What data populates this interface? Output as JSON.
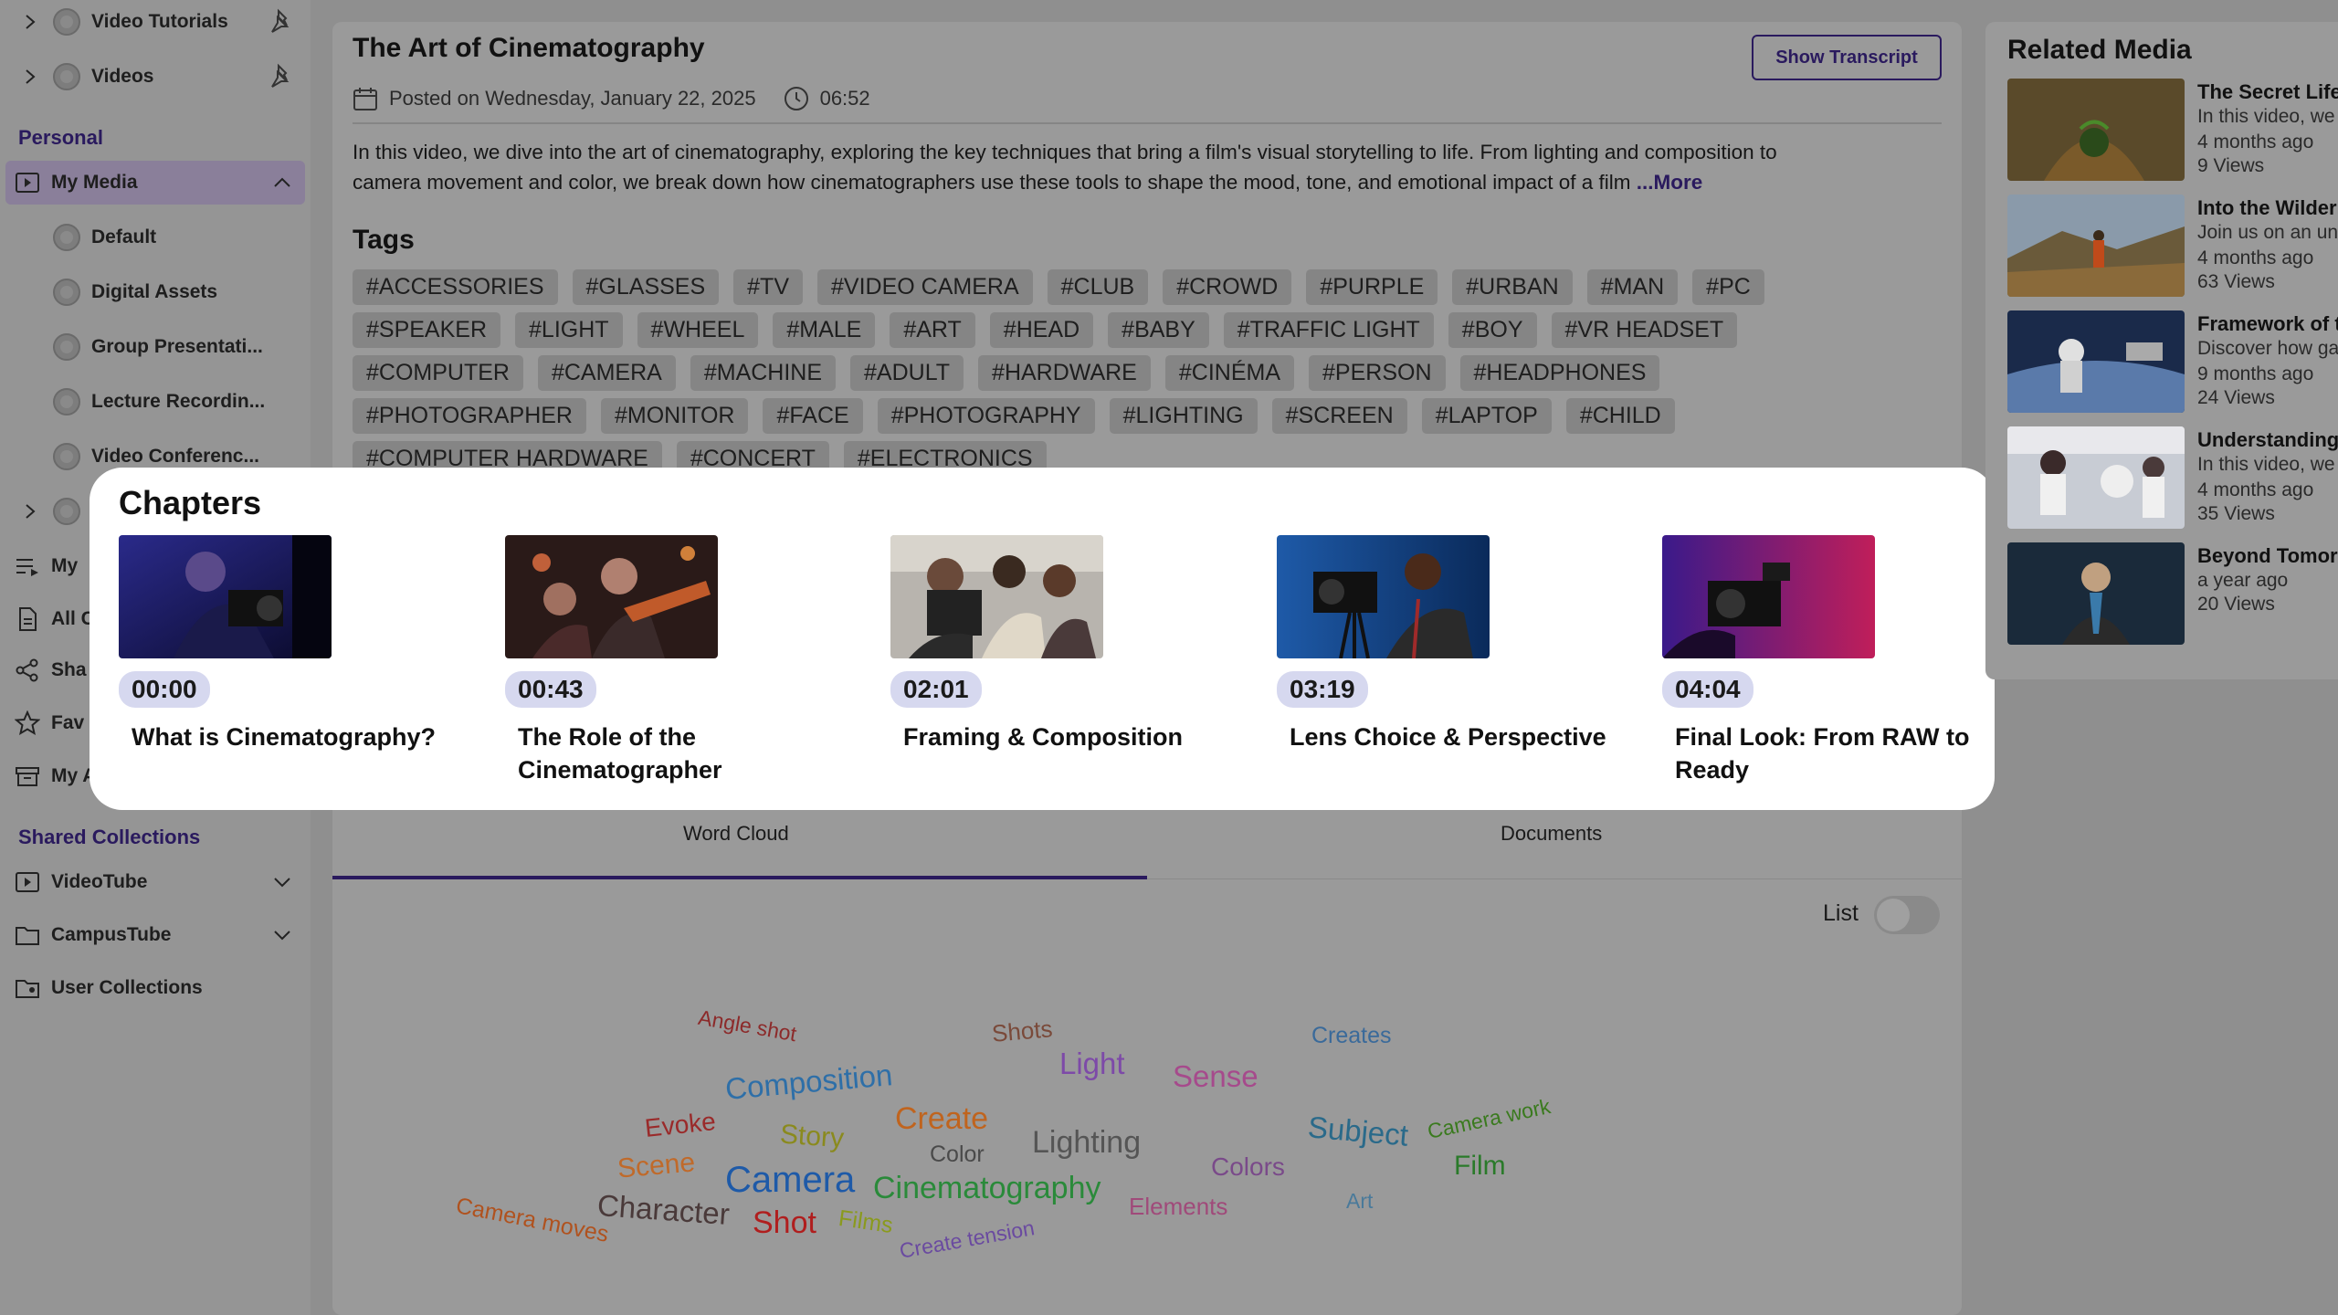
{
  "sidebar": {
    "top_items": [
      {
        "label": "Video Tutorials"
      },
      {
        "label": "Videos"
      }
    ],
    "personal_header": "Personal",
    "my_media": "My Media",
    "sub_items": [
      "Default",
      "Digital Assets",
      "Group Presentati...",
      "Lecture Recordin...",
      "Video Conferenc..."
    ],
    "misc_items": [
      "My",
      "All C",
      "Sha",
      "Fav",
      "My A"
    ],
    "shared_header": "Shared Collections",
    "shared_items": [
      "VideoTube",
      "CampusTube",
      "User Collections"
    ]
  },
  "video": {
    "title": "The Art of Cinematography",
    "posted": "Posted on Wednesday, January 22, 2025",
    "duration": "06:52",
    "transcript_button": "Show Transcript",
    "description_line1": "In this video, we dive into the art of cinematography, exploring the key techniques that bring a film's visual storytelling to life. From lighting and composition to",
    "description_line2": "camera movement and color, we break down how cinematographers use these tools to shape the mood, tone, and emotional impact of a film",
    "more_link": "...More"
  },
  "tags_header": "Tags",
  "tags": [
    "#ACCESSORIES",
    "#GLASSES",
    "#TV",
    "#VIDEO CAMERA",
    "#CLUB",
    "#CROWD",
    "#PURPLE",
    "#URBAN",
    "#MAN",
    "#PC",
    "#SPEAKER",
    "#LIGHT",
    "#WHEEL",
    "#MALE",
    "#ART",
    "#HEAD",
    "#BABY",
    "#TRAFFIC LIGHT",
    "#BOY",
    "#VR HEADSET",
    "#COMPUTER",
    "#CAMERA",
    "#MACHINE",
    "#ADULT",
    "#HARDWARE",
    "#CINÉMA",
    "#PERSON",
    "#HEADPHONES",
    "#PHOTOGRAPHER",
    "#MONITOR",
    "#FACE",
    "#PHOTOGRAPHY",
    "#LIGHTING",
    "#SCREEN",
    "#LAPTOP",
    "#CHILD",
    "#COMPUTER HARDWARE",
    "#CONCERT",
    "#ELECTRONICS"
  ],
  "chapters": {
    "title": "Chapters",
    "items": [
      {
        "time": "00:00",
        "name": "What is Cinematography?"
      },
      {
        "time": "00:43",
        "name": "The Role of the Cinematographer"
      },
      {
        "time": "02:01",
        "name": "Framing & Composition"
      },
      {
        "time": "03:19",
        "name": "Lens Choice & Perspective"
      },
      {
        "time": "04:04",
        "name": "Final Look: From RAW to Ready"
      }
    ]
  },
  "tabs": {
    "word_cloud": "Word Cloud",
    "documents": "Documents"
  },
  "list_toggle": {
    "label": "List",
    "on": false
  },
  "word_cloud": [
    {
      "text": "Angle shot",
      "color": "#8c2a2a"
    },
    {
      "text": "Shots",
      "color": "#7a4a3a"
    },
    {
      "text": "Light",
      "color": "#7d4aa8"
    },
    {
      "text": "Sense",
      "color": "#a64a8c"
    },
    {
      "text": "Creates",
      "color": "#3a6a9a"
    },
    {
      "text": "Composition",
      "color": "#2e6fa8"
    },
    {
      "text": "Evoke",
      "color": "#9a2a2a"
    },
    {
      "text": "Story",
      "color": "#8a8a1e"
    },
    {
      "text": "Create",
      "color": "#c0641e"
    },
    {
      "text": "Color",
      "color": "#4a4a4a"
    },
    {
      "text": "Lighting",
      "color": "#555555"
    },
    {
      "text": "Subject",
      "color": "#2a6a8a"
    },
    {
      "text": "Camera work",
      "color": "#3a7a1e"
    },
    {
      "text": "Scene",
      "color": "#c06a2a"
    },
    {
      "text": "Camera",
      "color": "#1e5aa8"
    },
    {
      "text": "Cinematography",
      "color": "#2a8a3a"
    },
    {
      "text": "Colors",
      "color": "#7a4a8a"
    },
    {
      "text": "Film",
      "color": "#2a7a2a"
    },
    {
      "text": "Character",
      "color": "#4a3a3a"
    },
    {
      "text": "Shot",
      "color": "#b01e1e"
    },
    {
      "text": "Films",
      "color": "#8a9a1e"
    },
    {
      "text": "Elements",
      "color": "#a04a7a"
    },
    {
      "text": "Art",
      "color": "#4a7a9a"
    },
    {
      "text": "Camera moves",
      "color": "#b0521e"
    },
    {
      "text": "Create tension",
      "color": "#6a4aa0"
    }
  ],
  "related": {
    "title": "Related Media",
    "items": [
      {
        "title": "The Secret Life",
        "desc": "In this video, we",
        "age": "4 months ago",
        "views": "9 Views"
      },
      {
        "title": "Into the Wilder",
        "desc": "Join us on an un",
        "age": "4 months ago",
        "views": "63 Views"
      },
      {
        "title": "Framework of t",
        "desc": "Discover how ga",
        "age": "9 months ago",
        "views": "24 Views"
      },
      {
        "title": "Understanding",
        "desc": "In this video, we",
        "age": "4 months ago",
        "views": "35 Views"
      },
      {
        "title": "Beyond Tomor",
        "desc": "",
        "age": "a year ago",
        "views": "20 Views"
      }
    ]
  },
  "colors": {
    "accent": "#2a1a5e",
    "chapter_badge": "#d6d8ef"
  }
}
